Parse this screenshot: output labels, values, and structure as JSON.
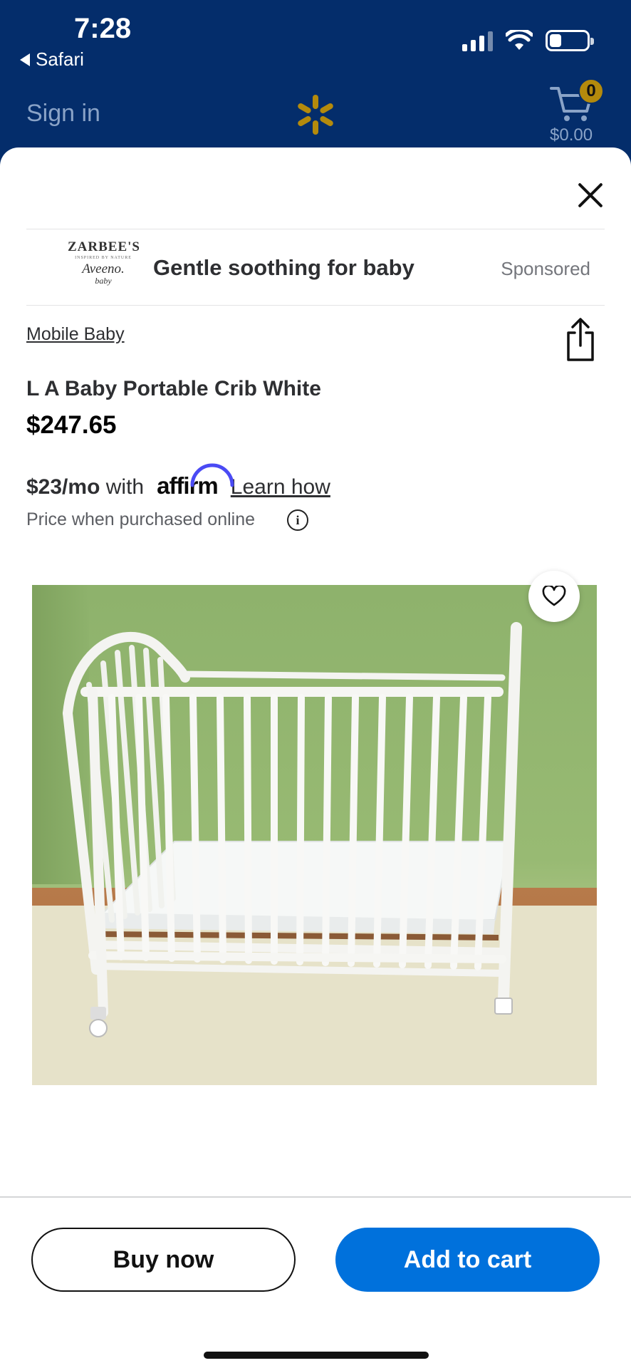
{
  "status_bar": {
    "time": "7:28",
    "back_app": "Safari",
    "icons": [
      "signal-icon",
      "wifi-icon",
      "battery-icon"
    ]
  },
  "header": {
    "sign_in": "Sign in",
    "logo_icon": "walmart-spark-icon",
    "cart_count": "0",
    "cart_total": "$0.00"
  },
  "ad": {
    "brand_logo_lines": [
      "ZARBEE'S",
      "INSPIRED BY NATURE",
      "Aveeno.",
      "baby"
    ],
    "headline": "Gentle soothing for baby",
    "label": "Sponsored"
  },
  "product": {
    "brand": "Mobile Baby",
    "title": "L A Baby Portable Crib White",
    "price": "$247.65",
    "monthly_amount": "$23/mo",
    "monthly_with": "with",
    "affirm_logo": "affirm",
    "learn_how": "Learn how",
    "price_note": "Price when purchased online",
    "info_glyph": "i"
  },
  "actions": {
    "buy_now": "Buy now",
    "add_to_cart": "Add to cart"
  },
  "colors": {
    "header_bg": "#042d6b",
    "primary_blue": "#0071dc",
    "spark_yellow": "#b48a0c",
    "affirm_arc": "#4a4af4"
  }
}
